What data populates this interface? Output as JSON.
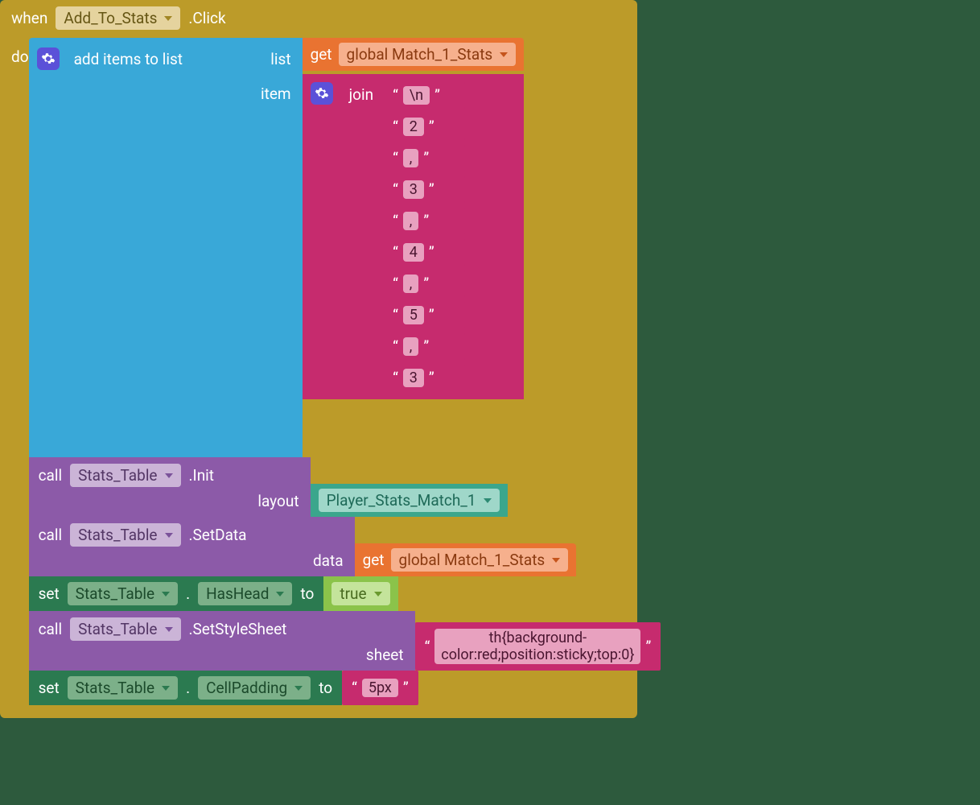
{
  "event": {
    "when": "when",
    "component": "Add_To_Stats",
    "suffix": ".Click",
    "do": "do"
  },
  "addItems": {
    "label": "add items to list",
    "listLabel": "list",
    "itemLabel": "item"
  },
  "get": {
    "label": "get",
    "var": "global Match_1_Stats"
  },
  "join": {
    "label": "join",
    "parts": [
      "\\n",
      "2",
      ",",
      "3",
      ",",
      "4",
      ",",
      "5",
      ",",
      "3"
    ]
  },
  "callInit": {
    "call": "call",
    "component": "Stats_Table",
    "method": ".Init",
    "param": "layout",
    "layout": "Player_Stats_Match_1"
  },
  "callSetData": {
    "call": "call",
    "component": "Stats_Table",
    "method": ".SetData",
    "param": "data",
    "get": "get",
    "var": "global Match_1_Stats"
  },
  "setHasHead": {
    "set": "set",
    "component": "Stats_Table",
    "dot": ".",
    "prop": "HasHead",
    "to": "to",
    "value": "true"
  },
  "callSetStyle": {
    "call": "call",
    "component": "Stats_Table",
    "method": ".SetStyleSheet",
    "param": "sheet",
    "value": "th{background-color:red;position:sticky;top:0}"
  },
  "setCellPadding": {
    "set": "set",
    "component": "Stats_Table",
    "dot": ".",
    "prop": "CellPadding",
    "to": "to",
    "value": "5px"
  },
  "q": "“",
  "qc": "”"
}
